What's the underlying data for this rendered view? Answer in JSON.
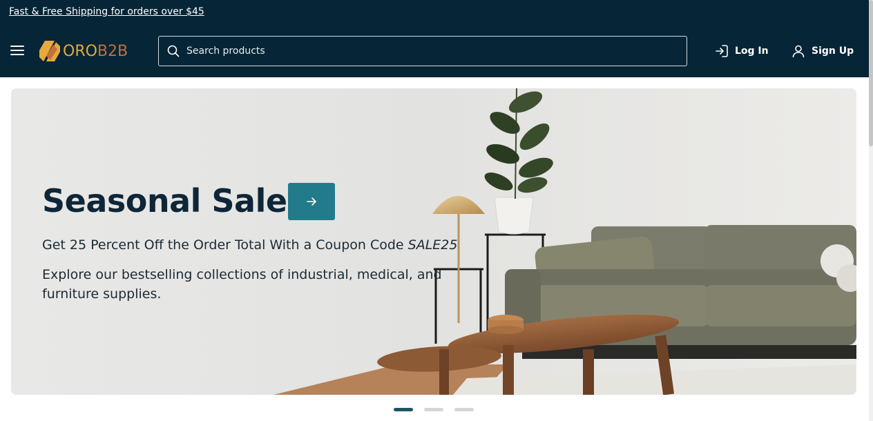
{
  "promo_bar": {
    "text": "Fast & Free Shipping for orders over $45"
  },
  "header": {
    "menu_icon": "hamburger-menu-icon",
    "logo": {
      "text_oro": "ORO",
      "text_b2b": "B2B",
      "colors": {
        "primary": "#e6a93c",
        "secondary": "#c2703a"
      }
    },
    "search": {
      "placeholder": "Search products",
      "value": "",
      "icon": "search-icon"
    },
    "login": {
      "label": "Log In",
      "icon": "login-icon"
    },
    "signup": {
      "label": "Sign Up",
      "icon": "user-icon"
    },
    "background_color": "#062537"
  },
  "hero": {
    "title": "Seasonal Sale",
    "cta_icon": "arrow-right-icon",
    "cta_color": "#237a8a",
    "coupon_text": "Get 25 Percent Off the Order Total With a Coupon Code",
    "coupon_code": "SALE25",
    "description": "Explore our bestselling collections of industrial, medical, and furniture supplies.",
    "image": "living-room-sofa-plant-coffee-table"
  },
  "carousel": {
    "slide_count": 3,
    "active_index": 0,
    "active_color": "#1e5566",
    "inactive_color": "#d6d6d6"
  }
}
